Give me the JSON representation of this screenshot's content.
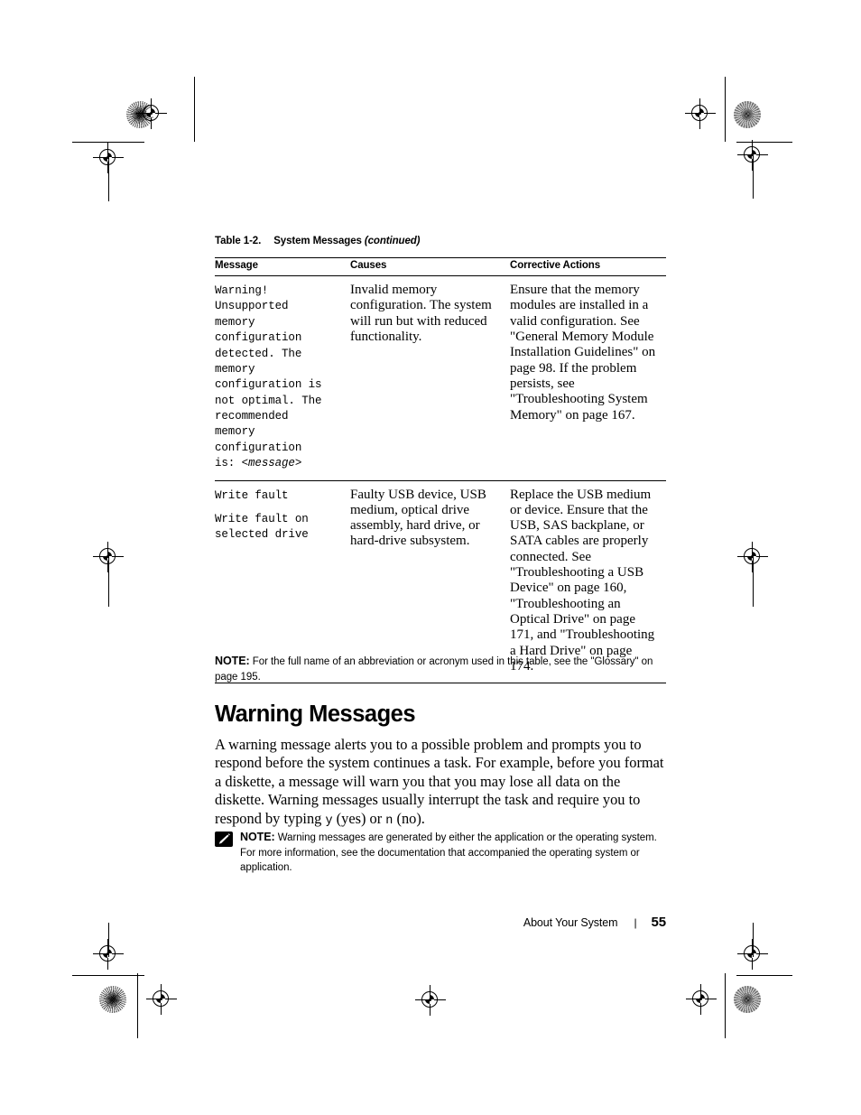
{
  "table": {
    "caption_number": "Table 1-2.",
    "caption_title": "System Messages",
    "caption_continued": "(continued)",
    "headers": {
      "message": "Message",
      "causes": "Causes",
      "actions": "Corrective Actions"
    },
    "rows": [
      {
        "message_lines": [
          "Warning!",
          "Unsupported",
          "memory",
          "configuration",
          "detected. The",
          "memory",
          "configuration is",
          "not optimal. The",
          "recommended",
          "memory",
          "configuration"
        ],
        "message_last_prefix": "is: ",
        "message_last_variable": "<message>",
        "causes": "Invalid memory configuration. The system will run but with reduced functionality.",
        "actions": "Ensure that the memory modules are installed in a valid configuration. See \"General Memory Module Installation Guidelines\" on page 98. If the problem persists, see \"Troubleshooting System Memory\" on page 167."
      },
      {
        "message_lines": [
          "Write fault"
        ],
        "message_lines_2": [
          "Write fault on",
          "selected drive"
        ],
        "causes": "Faulty USB device, USB medium, optical drive assembly, hard drive, or hard-drive subsystem.",
        "actions_para1": "Replace the USB medium or device. Ensure that the USB, SAS backplane, or SATA cables are properly connected.",
        "actions_para2": "See \"Troubleshooting a USB Device\" on page 160, \"Troubleshooting an Optical Drive\" on page 171, and \"Troubleshooting a Hard Drive\" on page 174."
      }
    ],
    "note_label": "NOTE:",
    "note_text": " For the full name of an abbreviation or acronym used in this table, see the \"Glossary\" on page 195."
  },
  "section": {
    "title": "Warning Messages",
    "paragraph_part1": "A warning message alerts you to a possible problem and prompts you to respond before the system continues a task. For example, before you format a diskette, a message will warn you that you may lose all data on the diskette. Warning messages usually interrupt the task and require you to respond by typing ",
    "paragraph_key_yes": "y",
    "paragraph_part2": " (yes) or ",
    "paragraph_key_no": "n",
    "paragraph_part3": " (no)."
  },
  "note_box": {
    "icon": "pencil-note-icon",
    "label": "NOTE:",
    "text": " Warning messages are generated by either the application or the operating system. For more information, see the documentation that accompanied the operating system or application."
  },
  "footer": {
    "title": "About Your System",
    "separator": "|",
    "page_number": "55"
  },
  "colors": {
    "text": "#000000",
    "background": "#ffffff",
    "rule": "#000000"
  }
}
